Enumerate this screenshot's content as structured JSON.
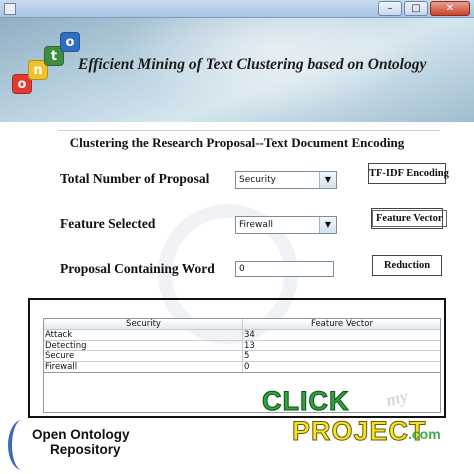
{
  "window": {
    "minimize": "–",
    "maximize": "□",
    "close": "✕"
  },
  "header": {
    "title": "Efficient Mining of Text Clustering based on Ontology",
    "logo_letters": [
      "o",
      "n",
      "t",
      "o"
    ]
  },
  "main": {
    "section_title": "Clustering the Research Proposal--Text Document Encoding",
    "form": {
      "total_label": "Total Number of Proposal",
      "total_select": "Security",
      "feature_label": "Feature Selected",
      "feature_select": "Firewall",
      "word_label": "Proposal Containing Word",
      "word_value": "0"
    },
    "buttons": {
      "tfidf": "TF-IDF Encoding",
      "feature_vector": "Feature Vector",
      "reduction": "Reduction"
    },
    "table": {
      "headers": [
        "Security",
        "Feature Vector"
      ],
      "rows": [
        [
          "Attack",
          "34"
        ],
        [
          "Detecting",
          "13"
        ],
        [
          "Secure",
          "5"
        ],
        [
          "Firewall",
          "0"
        ]
      ]
    }
  },
  "footer": {
    "oor_line1": "Open Ontology",
    "oor_line2": "Repository",
    "brand_click": "CLICK",
    "brand_my": "my",
    "brand_project": "PROJECT",
    "brand_com": ".com"
  },
  "colors": {
    "logo": [
      "#e23a2f",
      "#f0c12a",
      "#3b8f3f",
      "#2f6fc1"
    ]
  }
}
